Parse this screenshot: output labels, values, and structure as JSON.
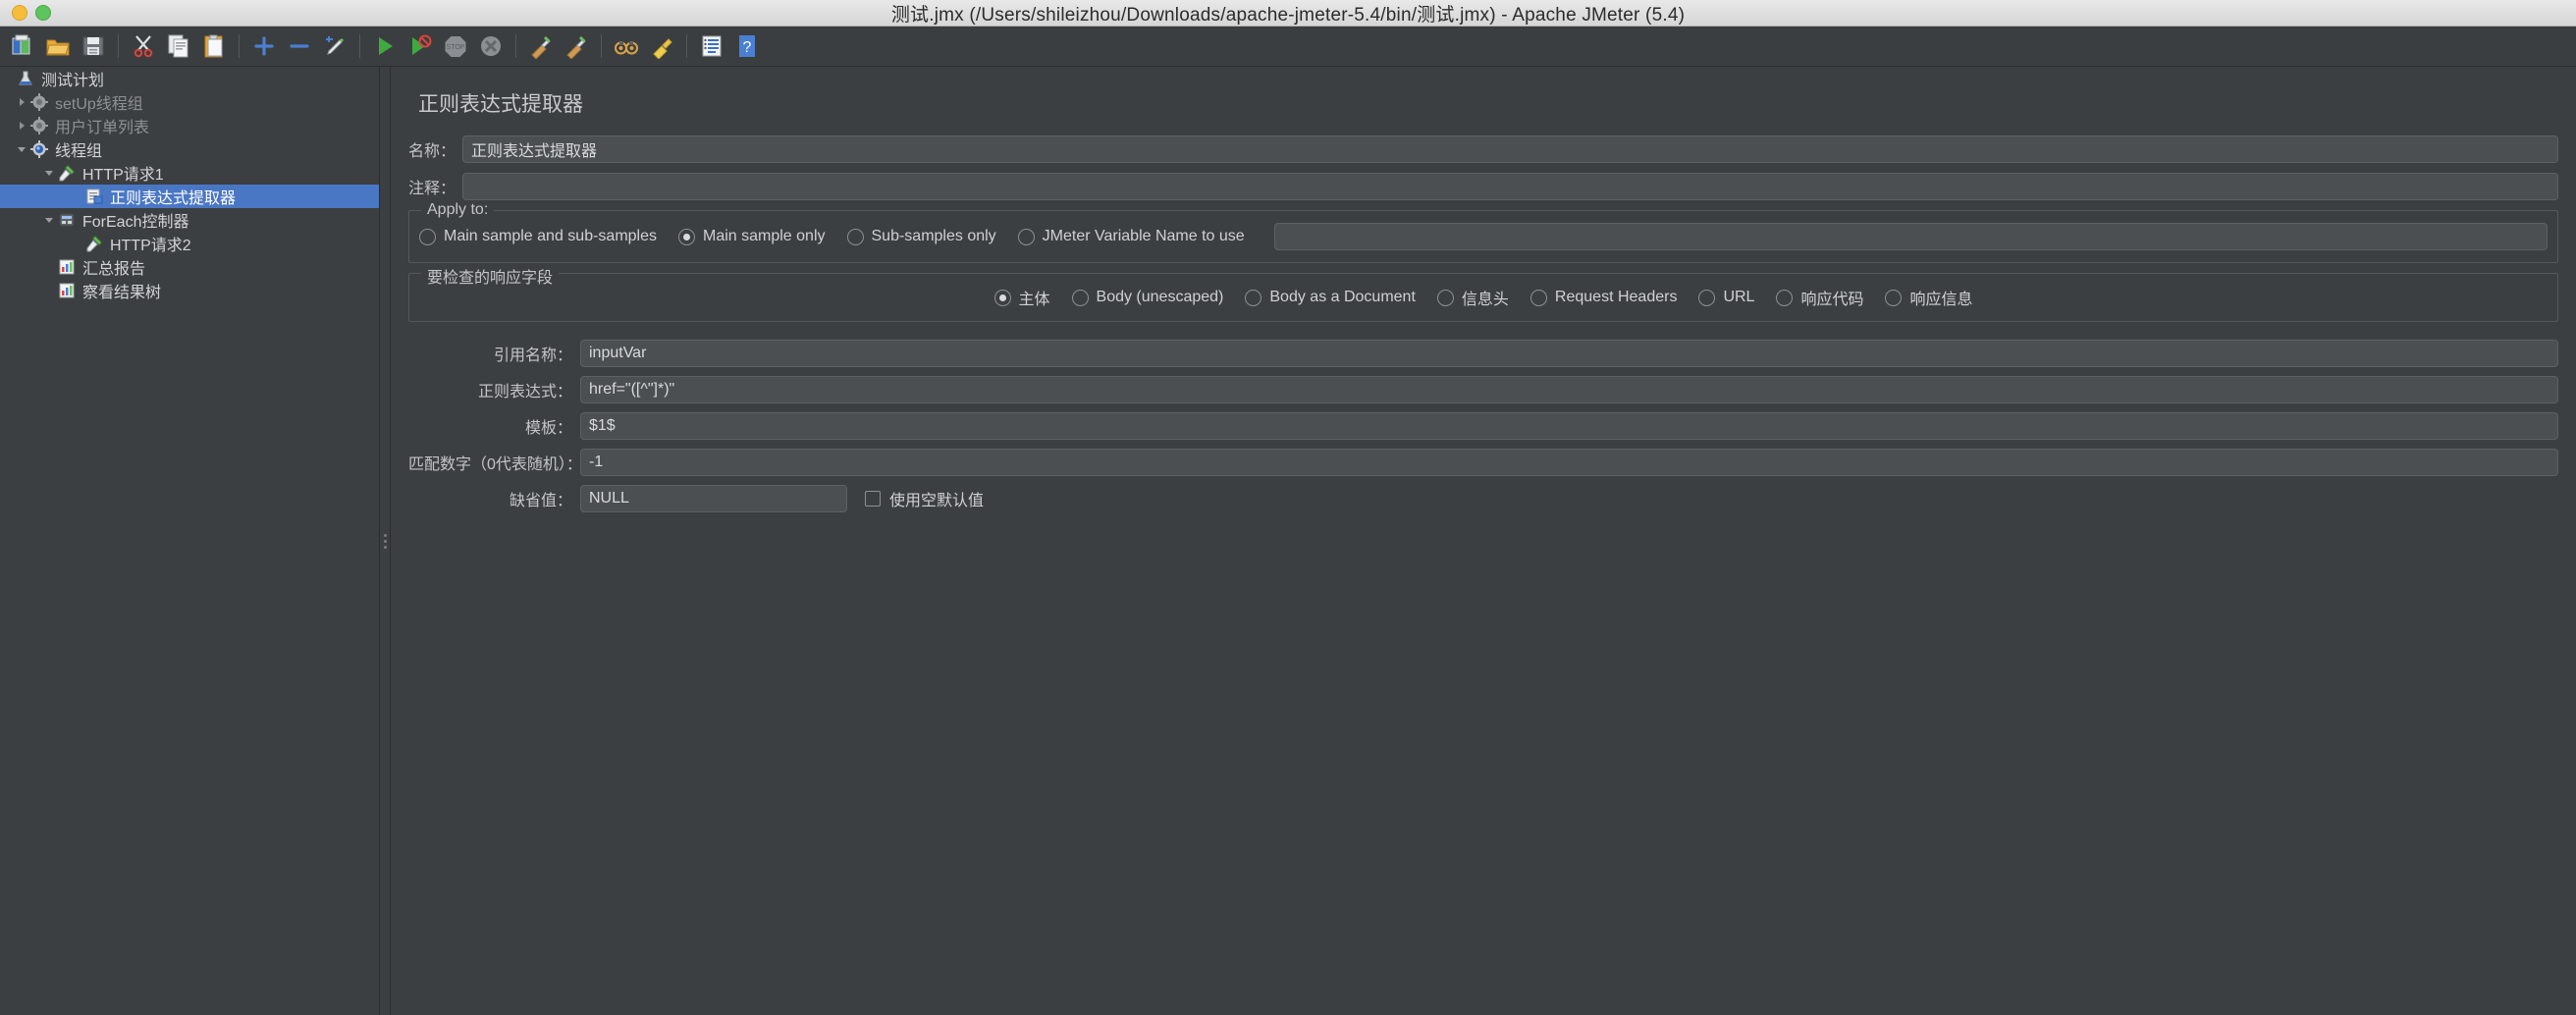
{
  "window": {
    "title": "测试.jmx (/Users/shileizhou/Downloads/apache-jmeter-5.4/bin/测试.jmx) - Apache JMeter (5.4)"
  },
  "toolbar": {
    "buttons": [
      {
        "name": "new-test-plan",
        "icon": "new-document-icon"
      },
      {
        "name": "open",
        "icon": "open-folder-icon"
      },
      {
        "name": "save",
        "icon": "save-disk-icon"
      },
      {
        "name": "cut",
        "icon": "scissors-icon"
      },
      {
        "name": "copy",
        "icon": "copy-icon"
      },
      {
        "name": "paste",
        "icon": "clipboard-paste-icon"
      },
      {
        "name": "expand-all",
        "icon": "plus-icon"
      },
      {
        "name": "collapse-all",
        "icon": "minus-icon"
      },
      {
        "name": "toggle",
        "icon": "pencil-toggle-icon"
      },
      {
        "name": "start",
        "icon": "green-play-icon"
      },
      {
        "name": "start-no-pause",
        "icon": "green-play-no-timer-icon"
      },
      {
        "name": "stop",
        "icon": "stop-sign-icon"
      },
      {
        "name": "shutdown",
        "icon": "shutdown-x-icon"
      },
      {
        "name": "clear",
        "icon": "broom-clear-icon"
      },
      {
        "name": "clear-all",
        "icon": "broom-clear-all-icon"
      },
      {
        "name": "search",
        "icon": "binoculars-icon"
      },
      {
        "name": "reset-search",
        "icon": "yellow-broom-icon"
      },
      {
        "name": "function-helper",
        "icon": "function-list-icon"
      },
      {
        "name": "help",
        "icon": "question-help-icon"
      }
    ]
  },
  "tree": {
    "items": [
      {
        "label": "测试计划",
        "icon": "flask-icon",
        "depth": 0,
        "twisty": "none",
        "selected": false,
        "dim": false
      },
      {
        "label": "setUp线程组",
        "icon": "gear-gray-icon",
        "depth": 1,
        "twisty": "collapsed",
        "selected": false,
        "dim": true
      },
      {
        "label": "用户订单列表",
        "icon": "gear-gray-icon",
        "depth": 1,
        "twisty": "collapsed",
        "selected": false,
        "dim": true
      },
      {
        "label": "线程组",
        "icon": "gear-blue-icon",
        "depth": 1,
        "twisty": "expanded",
        "selected": false,
        "dim": false
      },
      {
        "label": "HTTP请求1",
        "icon": "pipette-green-icon",
        "depth": 2,
        "twisty": "expanded",
        "selected": false,
        "dim": false
      },
      {
        "label": "正则表达式提取器",
        "icon": "extractor-icon",
        "depth": 3,
        "twisty": "none",
        "selected": true,
        "dim": false
      },
      {
        "label": "ForEach控制器",
        "icon": "controller-icon",
        "depth": 2,
        "twisty": "expanded",
        "selected": false,
        "dim": false
      },
      {
        "label": "HTTP请求2",
        "icon": "pipette-green-icon",
        "depth": 3,
        "twisty": "none",
        "selected": false,
        "dim": false
      },
      {
        "label": "汇总报告",
        "icon": "chart-report-icon",
        "depth": 2,
        "twisty": "none",
        "selected": false,
        "dim": false
      },
      {
        "label": "察看结果树",
        "icon": "chart-report-icon",
        "depth": 2,
        "twisty": "none",
        "selected": false,
        "dim": false
      }
    ]
  },
  "panel": {
    "title": "正则表达式提取器",
    "name_label": "名称：",
    "name_value": "正则表达式提取器",
    "comment_label": "注释：",
    "comment_value": "",
    "apply_to": {
      "group_title": "Apply to:",
      "options": [
        {
          "label": "Main sample and sub-samples",
          "checked": false
        },
        {
          "label": "Main sample only",
          "checked": true
        },
        {
          "label": "Sub-samples only",
          "checked": false
        },
        {
          "label": "JMeter Variable Name to use",
          "checked": false
        }
      ],
      "variable_value": ""
    },
    "field_to_check": {
      "group_title": "要检查的响应字段",
      "options": [
        {
          "label": "主体",
          "checked": true
        },
        {
          "label": "Body (unescaped)",
          "checked": false
        },
        {
          "label": "Body as a Document",
          "checked": false
        },
        {
          "label": "信息头",
          "checked": false
        },
        {
          "label": "Request Headers",
          "checked": false
        },
        {
          "label": "URL",
          "checked": false
        },
        {
          "label": "响应代码",
          "checked": false
        },
        {
          "label": "响应信息",
          "checked": false
        }
      ]
    },
    "fields": {
      "ref_name_label": "引用名称：",
      "ref_name_value": "inputVar",
      "regex_label": "正则表达式：",
      "regex_value": "href=\"([^\"]*)\"",
      "template_label": "模板：",
      "template_value": "$1$",
      "match_no_label": "匹配数字（0代表随机）：",
      "match_no_value": "-1",
      "default_label": "缺省值：",
      "default_value": "NULL",
      "use_empty_default_label": "使用空默认值",
      "use_empty_default_checked": false
    }
  },
  "colors": {
    "selection": "#4a77c4",
    "panel_bg": "#3c3f41",
    "input_bg": "#4b4f51",
    "titlebar_bg": "#e0e0e0"
  }
}
